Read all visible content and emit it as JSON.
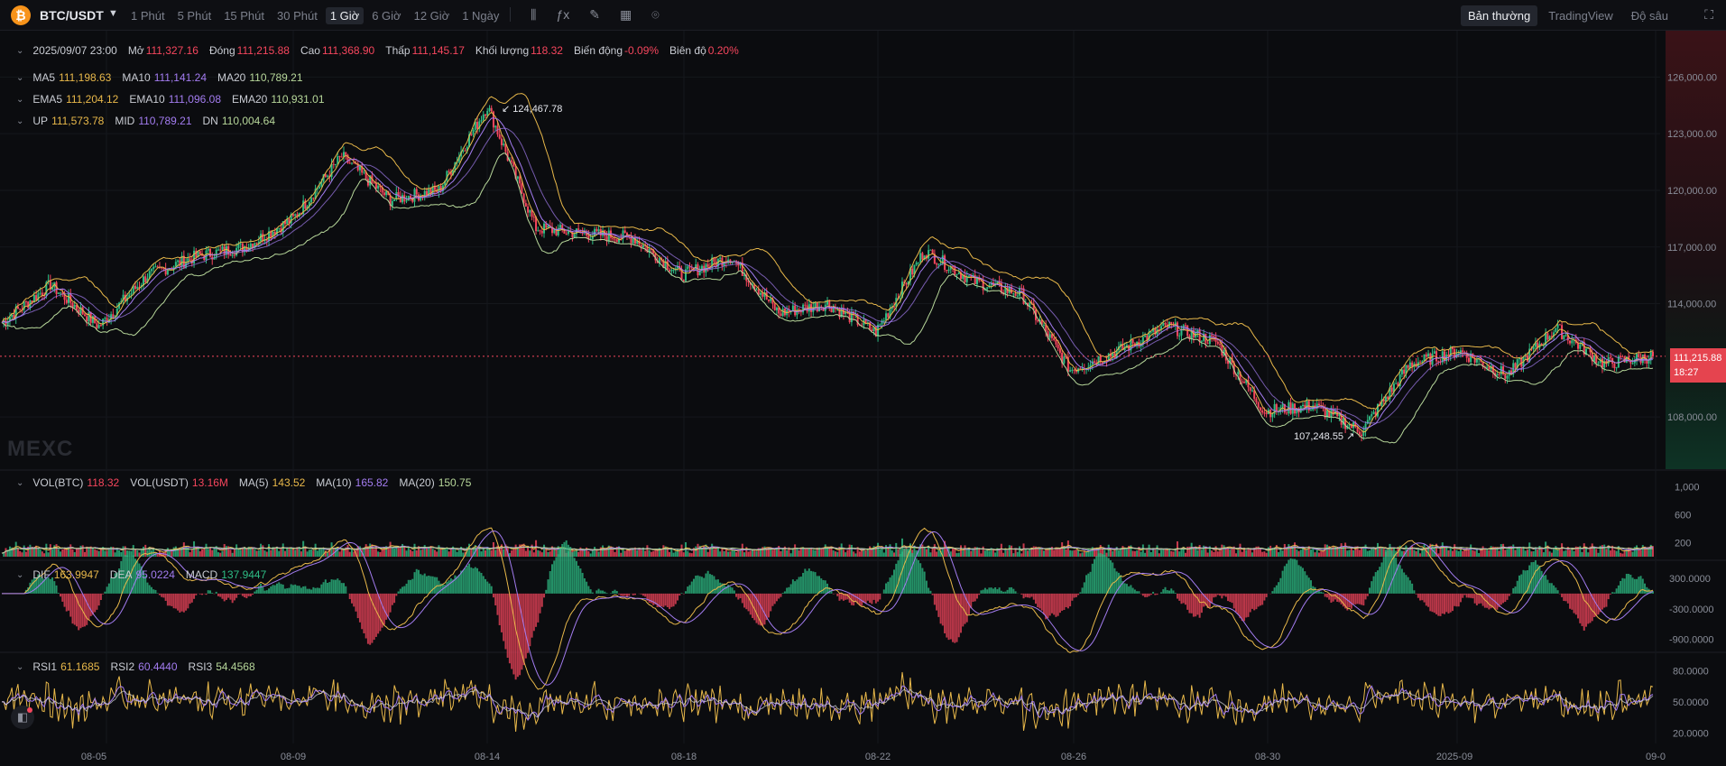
{
  "header": {
    "pair": "BTC/USDT",
    "coin_icon": "bitcoin-icon",
    "intervals": [
      "1 Phút",
      "5 Phút",
      "15 Phút",
      "30 Phút",
      "1 Giờ",
      "6 Giờ",
      "12 Giờ",
      "1 Ngày"
    ],
    "active_interval": "1 Giờ",
    "views": [
      "Bản thường",
      "TradingView",
      "Độ sâu"
    ],
    "active_view": "Bản thường"
  },
  "ohlc": {
    "datetime": "2025/09/07 23:00",
    "open_label": "Mở",
    "open": "111,327.16",
    "close_label": "Đóng",
    "close": "111,215.88",
    "high_label": "Cao",
    "high": "111,368.90",
    "low_label": "Thấp",
    "low": "111,145.17",
    "volume_label": "Khối lượng",
    "volume": "118.32",
    "change_label": "Biến động",
    "change": "-0.09%",
    "amplitude_label": "Biên độ",
    "amplitude": "0.20%"
  },
  "ma": {
    "ma5_label": "MA5",
    "ma5": "111,198.63",
    "ma10_label": "MA10",
    "ma10": "111,141.24",
    "ma20_label": "MA20",
    "ma20": "110,789.21"
  },
  "ema": {
    "ema5_label": "EMA5",
    "ema5": "111,204.12",
    "ema10_label": "EMA10",
    "ema10": "111,096.08",
    "ema20_label": "EMA20",
    "ema20": "110,931.01"
  },
  "boll": {
    "up_label": "UP",
    "up": "111,573.78",
    "mid_label": "MID",
    "mid": "110,789.21",
    "dn_label": "DN",
    "dn": "110,004.64"
  },
  "vol": {
    "btc_label": "VOL(BTC)",
    "btc": "118.32",
    "usdt_label": "VOL(USDT)",
    "usdt": "13.16M",
    "ma5_label": "MA(5)",
    "ma5": "143.52",
    "ma10_label": "MA(10)",
    "ma10": "165.82",
    "ma20_label": "MA(20)",
    "ma20": "150.75"
  },
  "macd": {
    "dif_label": "DIF",
    "dif": "163.9947",
    "dea_label": "DEA",
    "dea": "95.0224",
    "macd_label": "MACD",
    "macd": "137.9447"
  },
  "rsi": {
    "rsi1_label": "RSI1",
    "rsi1": "61.1685",
    "rsi2_label": "RSI2",
    "rsi2": "60.4440",
    "rsi3_label": "RSI3",
    "rsi3": "54.4568"
  },
  "annotations": {
    "max": "124,467.78",
    "min": "107,248.55"
  },
  "last_price": {
    "price": "111,215.88",
    "countdown": "18:27"
  },
  "watermark": "MEXC",
  "price_axis": [
    "126,000.00",
    "123,000.00",
    "120,000.00",
    "117,000.00",
    "114,000.00",
    "108,000.00"
  ],
  "vol_axis": [
    "1,000",
    "600",
    "200"
  ],
  "macd_axis": [
    "300.0000",
    "-300.0000",
    "-900.0000"
  ],
  "rsi_axis": [
    "80.0000",
    "50.0000",
    "20.0000"
  ],
  "time_axis": [
    "08-05",
    "08-09",
    "08-14",
    "08-18",
    "08-22",
    "08-26",
    "08-30",
    "2025-09",
    "09-0"
  ],
  "colors": {
    "up": "#2ebd85",
    "down": "#f6465d",
    "ma5": "#e8b84a",
    "ma10": "#a37cf0",
    "ma20": "#b7d79a",
    "bg": "#0b0c0f"
  },
  "chart_data": {
    "type": "candlestick",
    "x_range": [
      "2025-08-03",
      "2025-09-07"
    ],
    "price_key_points": [
      {
        "x": "08-03",
        "price": 113000
      },
      {
        "x": "08-05",
        "price": 115000
      },
      {
        "x": "08-06",
        "price": 112800
      },
      {
        "x": "08-07",
        "price": 115500
      },
      {
        "x": "08-08",
        "price": 116500
      },
      {
        "x": "08-09",
        "price": 117000
      },
      {
        "x": "08-10",
        "price": 118500
      },
      {
        "x": "08-11",
        "price": 121800
      },
      {
        "x": "08-12",
        "price": 119500
      },
      {
        "x": "08-13",
        "price": 120000
      },
      {
        "x": "08-14",
        "price": 124467.78
      },
      {
        "x": "08-15",
        "price": 118000
      },
      {
        "x": "08-16",
        "price": 117700
      },
      {
        "x": "08-17",
        "price": 117500
      },
      {
        "x": "08-18",
        "price": 115500
      },
      {
        "x": "08-19",
        "price": 116500
      },
      {
        "x": "08-20",
        "price": 113500
      },
      {
        "x": "08-21",
        "price": 114000
      },
      {
        "x": "08-22",
        "price": 112500
      },
      {
        "x": "08-23",
        "price": 116800
      },
      {
        "x": "08-24",
        "price": 115200
      },
      {
        "x": "08-25",
        "price": 114500
      },
      {
        "x": "08-26",
        "price": 110500
      },
      {
        "x": "08-27",
        "price": 111500
      },
      {
        "x": "08-28",
        "price": 112800
      },
      {
        "x": "08-29",
        "price": 112000
      },
      {
        "x": "08-30",
        "price": 108300
      },
      {
        "x": "08-31",
        "price": 108600
      },
      {
        "x": "09-01",
        "price": 107248.55
      },
      {
        "x": "09-02",
        "price": 110800
      },
      {
        "x": "09-03",
        "price": 111500
      },
      {
        "x": "09-04",
        "price": 110200
      },
      {
        "x": "09-05",
        "price": 112700
      },
      {
        "x": "09-06",
        "price": 110800
      },
      {
        "x": "09-07",
        "price": 111215.88
      }
    ],
    "ylim": [
      106000,
      127500
    ]
  }
}
